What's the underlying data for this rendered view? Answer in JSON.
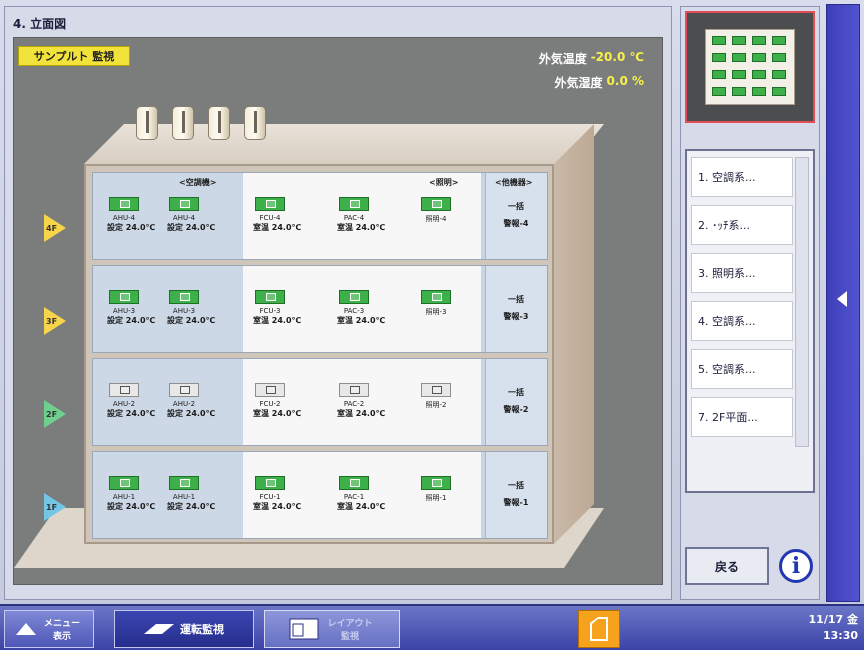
{
  "main": {
    "title": "4. 立面図",
    "sample_badge": "サンプルト 監視",
    "outside_temp": {
      "label": "外気温度",
      "value": "-20.0 ℃"
    },
    "outside_humidity": {
      "label": "外気湿度",
      "value": "0.0 %"
    },
    "zone_headers": {
      "air": "<空調機>",
      "lighting": "<照明>",
      "other": "<他機器>"
    }
  },
  "floors": [
    {
      "marker": "4F",
      "marker_color": "#f7d54a",
      "units": [
        {
          "name": "AHU-4",
          "set": "設定 24.0℃",
          "on": true
        },
        {
          "name": "AHU-4",
          "set": "設定 24.0℃",
          "on": true
        },
        {
          "name": "FCU-4",
          "set": "室温 24.0℃",
          "on": true
        },
        {
          "name": "PAC-4",
          "set": "室温 24.0℃",
          "on": true
        },
        {
          "name": "照明-4",
          "set": "",
          "on": true
        }
      ],
      "count": {
        "top": "一括",
        "bottom": "警報-4"
      }
    },
    {
      "marker": "3F",
      "marker_color": "#f7d54a",
      "units": [
        {
          "name": "AHU-3",
          "set": "設定 24.0℃",
          "on": true
        },
        {
          "name": "AHU-3",
          "set": "設定 24.0℃",
          "on": true
        },
        {
          "name": "FCU-3",
          "set": "室温 24.0℃",
          "on": true
        },
        {
          "name": "PAC-3",
          "set": "室温 24.0℃",
          "on": true
        },
        {
          "name": "照明-3",
          "set": "",
          "on": true
        }
      ],
      "count": {
        "top": "一括",
        "bottom": "警報-3"
      }
    },
    {
      "marker": "2F",
      "marker_color": "#6fd08e",
      "units": [
        {
          "name": "AHU-2",
          "set": "設定 24.0℃",
          "on": false
        },
        {
          "name": "AHU-2",
          "set": "設定 24.0℃",
          "on": false
        },
        {
          "name": "FCU-2",
          "set": "室温 24.0℃",
          "on": false
        },
        {
          "name": "PAC-2",
          "set": "室温 24.0℃",
          "on": false
        },
        {
          "name": "照明-2",
          "set": "",
          "on": false
        }
      ],
      "count": {
        "top": "一括",
        "bottom": "警報-2"
      }
    },
    {
      "marker": "1F",
      "marker_color": "#73c6e6",
      "units": [
        {
          "name": "AHU-1",
          "set": "設定 24.0℃",
          "on": true
        },
        {
          "name": "AHU-1",
          "set": "設定 24.0℃",
          "on": true
        },
        {
          "name": "FCU-1",
          "set": "室温 24.0℃",
          "on": true
        },
        {
          "name": "PAC-1",
          "set": "室温 24.0℃",
          "on": true
        },
        {
          "name": "照明-1",
          "set": "",
          "on": true
        }
      ],
      "count": {
        "top": "一括",
        "bottom": "警報-1"
      }
    }
  ],
  "floor_list": [
    "1. 空調系...",
    "2. ･ｯﾁ系...",
    "3. 照明系...",
    "4. 空調系...",
    "5. 空調系...",
    "7. 2F平面..."
  ],
  "right_panel": {
    "return_label": "戻る",
    "info_label": "i"
  },
  "taskbar": {
    "menu_label": "メニュー 表示",
    "operation_label": "運転監視",
    "layout_label": "レイアウト 監視",
    "clock_date": "11/17 金",
    "clock_time": "13:30"
  },
  "colors": {
    "on": "#3eb04a",
    "off": "#e8e8e8",
    "accent": "#3e3fb7",
    "alarm": "#f6a21d"
  }
}
